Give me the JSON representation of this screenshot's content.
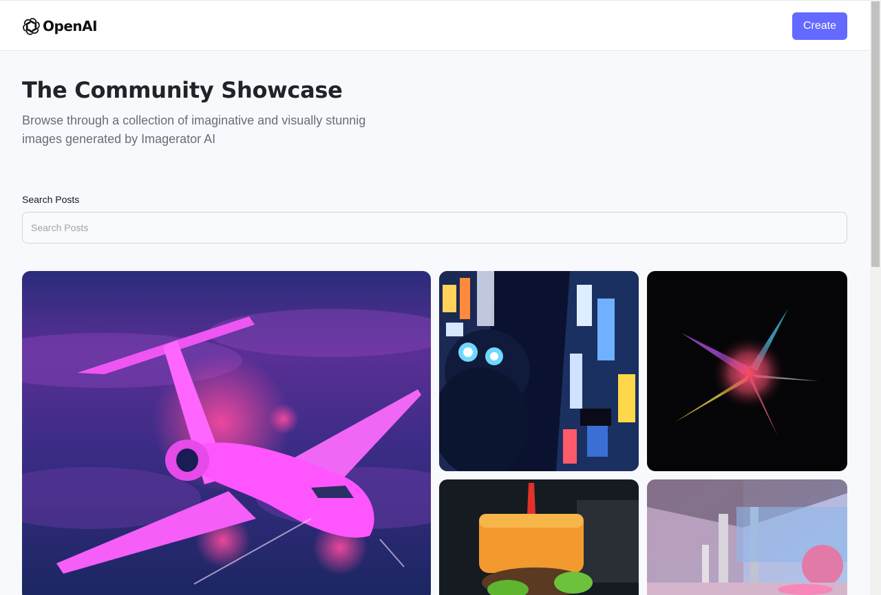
{
  "header": {
    "logo_text": "OpenAI",
    "create_label": "Create"
  },
  "hero": {
    "title": "The Community Showcase",
    "subtitle": "Browse through a collection of imaginative and visually stunnig images generated by Imagerator AI"
  },
  "search": {
    "label": "Search Posts",
    "placeholder": "Search Posts",
    "value": ""
  },
  "colors": {
    "accent": "#6469ff",
    "background": "#f8f9fc",
    "title": "#222328",
    "subtitle": "#666e75"
  },
  "gallery": {
    "images": [
      "pink airplane in purple sky",
      "robot in neon city",
      "colorful powder explosion",
      "cheese burger",
      "modern glass interior"
    ]
  }
}
